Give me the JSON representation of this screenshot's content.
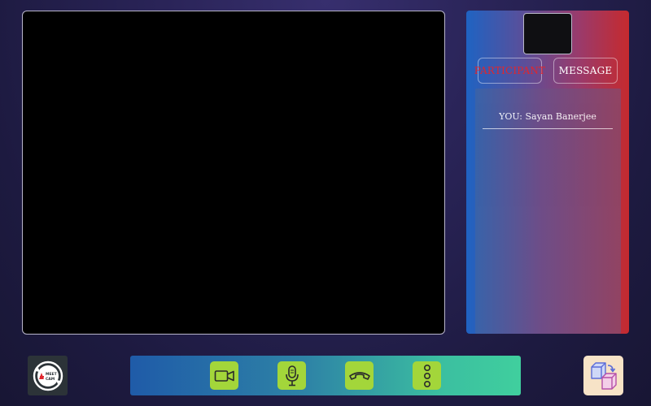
{
  "main": {
    "video_label": ""
  },
  "sidebar": {
    "tabs": [
      {
        "label": "PARTICIPANT",
        "active": true,
        "color": "#e0262e"
      },
      {
        "label": "MESSAGE",
        "active": false,
        "color": "#ffffff"
      }
    ],
    "participants": [
      {
        "label": "YOU: Sayan Banerjee"
      }
    ]
  },
  "logo": {
    "text_line1": "MEET",
    "text_line2": "CAM",
    "icon": "meet-cam-logo"
  },
  "controls": [
    {
      "icon": "video-camera-icon",
      "label": "Camera"
    },
    {
      "icon": "microphone-icon",
      "label": "Microphone"
    },
    {
      "icon": "hang-up-icon",
      "label": "End call"
    },
    {
      "icon": "more-options-icon",
      "label": "More"
    }
  ],
  "switch": {
    "icon": "switch-layout-icon"
  },
  "colors": {
    "accent_red": "#e0262e",
    "control_green": "#a3d63a",
    "panel_blue": "#1f63c2",
    "panel_red": "#c52a2e"
  }
}
